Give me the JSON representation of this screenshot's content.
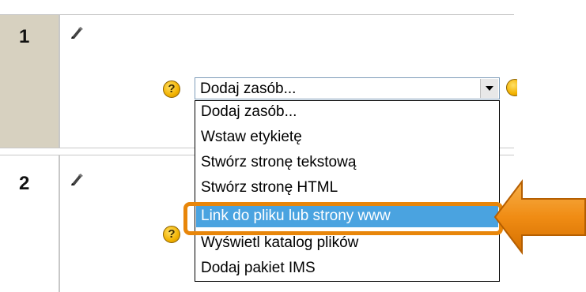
{
  "sections": [
    {
      "number": "1"
    },
    {
      "number": "2"
    }
  ],
  "help_icon_glyph": "?",
  "select": {
    "value": "Dodaj zasób..."
  },
  "dropdown_options": [
    {
      "label": "Dodaj zasób...",
      "selected": false
    },
    {
      "label": "Wstaw etykietę",
      "selected": false
    },
    {
      "label": "Stwórz stronę tekstową",
      "selected": false
    },
    {
      "label": "Stwórz stronę HTML",
      "selected": false
    },
    {
      "label": "Link do pliku lub strony www",
      "selected": true
    },
    {
      "label": "Wyświetl katalog plików",
      "selected": false
    },
    {
      "label": "Dodaj pakiet IMS",
      "selected": false
    }
  ],
  "colors": {
    "section_highlight": "#d7d1c0",
    "selected_option": "#4aa3e0",
    "callout_orange": "#e8860a"
  },
  "icons": {
    "edit": "pencil-hand-icon",
    "help": "help-icon"
  }
}
